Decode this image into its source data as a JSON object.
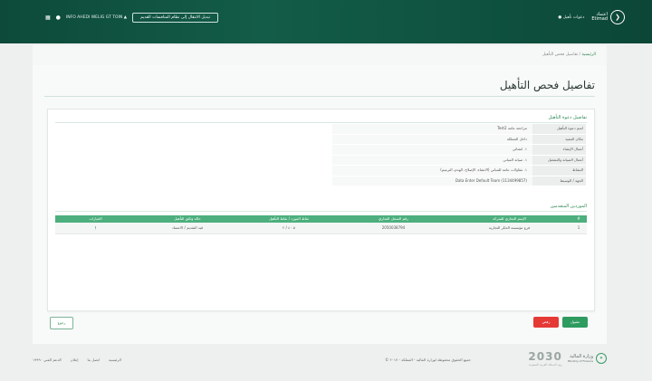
{
  "header": {
    "logo_line1": "اعتماد",
    "logo_line2": "Etimad",
    "user_name": "● دعوات تأهيل",
    "user_company": "INFO AHEDI WELIG GT TOIN ▲",
    "switch_button": "تبديل الانتقال إلى نظام المنافسات القديم"
  },
  "breadcrumb": {
    "home": "الرئيسية",
    "separator": "/",
    "current": "تفاصيل فحص التأهيل"
  },
  "page_title": "تفاصيل فحص التأهيل",
  "details": {
    "section_title": "تفاصيل دعوة التأهيل",
    "rows": [
      {
        "label": "اسم دعوة التأهيل",
        "value": "مراجعة عامة Test2"
      },
      {
        "label": "مكان التنفيذ",
        "value": "داخل المملكة"
      },
      {
        "label": "أعمال الإنشاء",
        "value": "١. انشائي"
      },
      {
        "label": "أعمال الصيانة والتشغيل",
        "value": "١. صيانة المباني"
      },
      {
        "label": "النشاط",
        "value": "١. مقاولات عامة للمباني (الانشاء، الإصلاح، الهدم، الترميم)"
      },
      {
        "label": "الجهة / الوسيط",
        "value": "Data Enter Default Team (1134499857)"
      }
    ]
  },
  "suppliers": {
    "section_title": "الموردين المتقدمين",
    "columns": [
      "#",
      "الإسم التجاري للشركة",
      "رقم السجل التجاري",
      "نقاط المورد / نقاط التأهيل",
      "حالة وثائق التأهيل",
      "الخيارات"
    ],
    "rows": [
      {
        "index": "1",
        "company": "فرع مؤسسة الحكر التجارية",
        "cr_number": "2050038794",
        "score": "٤٠.٥ / ٢",
        "status": "قيد التقديم / الاعتماد",
        "options": "⋮"
      }
    ]
  },
  "actions": {
    "accept": "مقبول",
    "reject": "رفض",
    "back": "رجوع"
  },
  "footer": {
    "org_name": "وزارة المالية",
    "org_name_en": "Ministry of Finance",
    "vision": "2030",
    "vision_tag": "رؤية المملكة العربية السعودية",
    "copyright": "جميع الحقوق محفوظة لوزارة المالية - المملكة - ٢٠١٧ ©",
    "links": [
      "الرئيسية",
      "اتصل بنا",
      "إعلان",
      "الدعم الفني ١٩٩٩٠"
    ]
  }
}
